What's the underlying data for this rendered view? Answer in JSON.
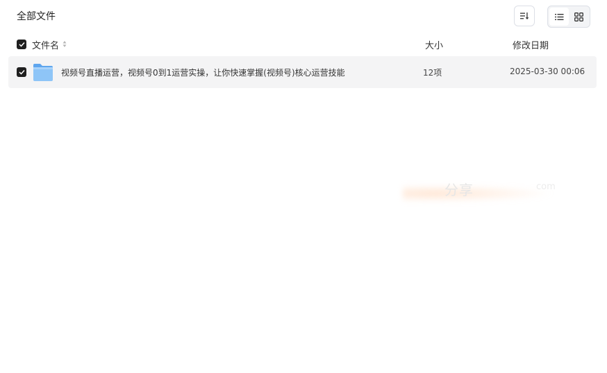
{
  "header": {
    "title": "全部文件"
  },
  "columns": {
    "name": "文件名",
    "size": "大小",
    "date": "修改日期"
  },
  "files": [
    {
      "name": "视频号直播运营，视频号0到1运营实操，让你快速掌握(视频号)核心运营技能",
      "size": "12项",
      "date": "2025-03-30 00:06",
      "icon": "folder-icon",
      "selected": true
    }
  ],
  "toolbar": {
    "sort_icon": "sort-icon",
    "list_view_icon": "list-view-icon",
    "grid_view_icon": "grid-view-icon",
    "active_view": "list"
  },
  "watermark": {
    "text": "分享",
    "domain": "com"
  },
  "colors": {
    "checkbox": "#1f1f1f",
    "row_bg": "#f4f4f5",
    "folder": "#7ab8f5"
  }
}
